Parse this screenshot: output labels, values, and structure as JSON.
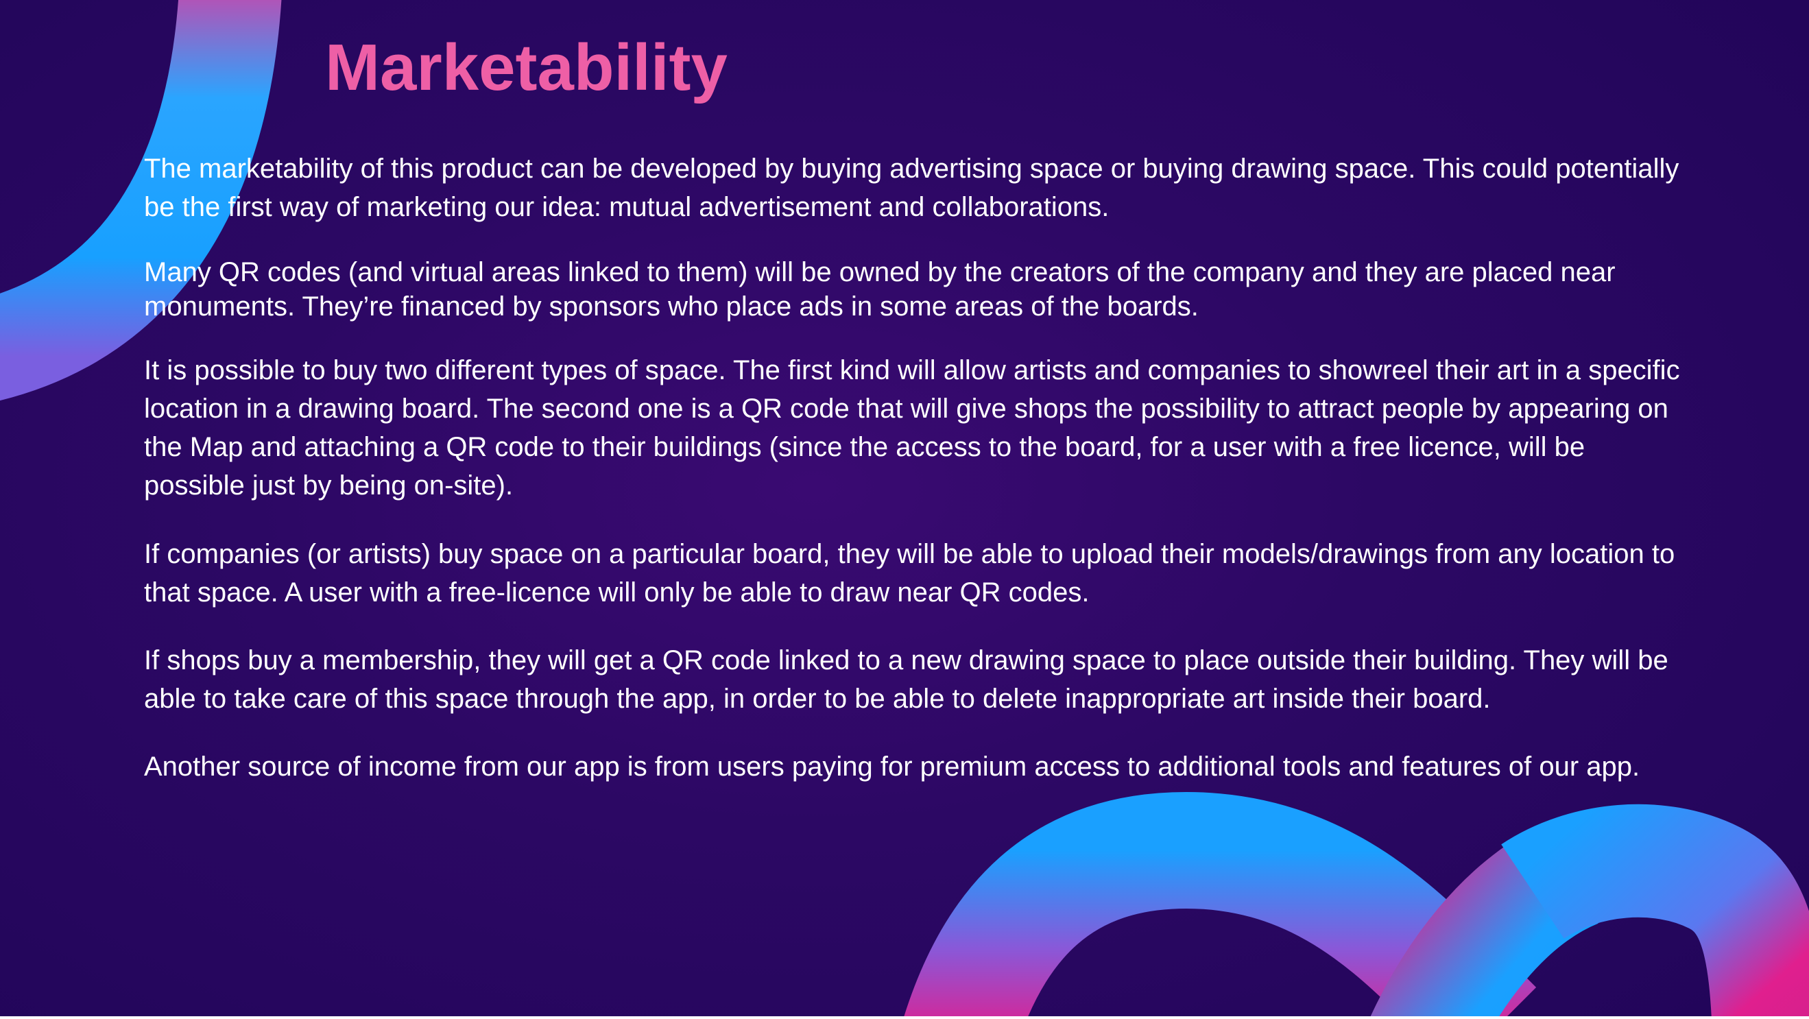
{
  "slide": {
    "title": "Marketability",
    "paragraphs": [
      "The marketability of this product can be developed by buying advertising space or buying drawing space. This could potentially be the first way of marketing our idea: mutual advertisement and collaborations.",
      "Many QR codes (and virtual areas linked to them) will be owned by the creators of the company and they are placed near monuments. They’re financed by sponsors who place ads in some areas of the boards.",
      "It is possible to buy two different types of space. The first kind will allow artists and companies to showreel their art in a specific location in a drawing board. The second one is a QR code that will give shops the possibility to attract people by appearing on the Map and attaching a QR code to their buildings (since the access to the board, for a user with a free licence, will be possible just by being on-site).",
      "If companies (or artists) buy space on a particular board, they will be able to upload their models/drawings from any location to that space. A user with a free-licence will only be able to draw near QR codes.",
      "If shops buy a membership, they will get a QR code linked to a new drawing space to place outside their building. They will be able to take care of this space through the app, in order to be able to delete inappropriate art inside their board.",
      "Another source of income from our app is from users paying for premium access to additional tools and features of our app."
    ]
  },
  "colors": {
    "background": "#2c0864",
    "title": "#ee5fa6",
    "text": "#ffffff",
    "ribbon_blue": "#1aa0ff",
    "ribbon_pink": "#e01f8e"
  }
}
